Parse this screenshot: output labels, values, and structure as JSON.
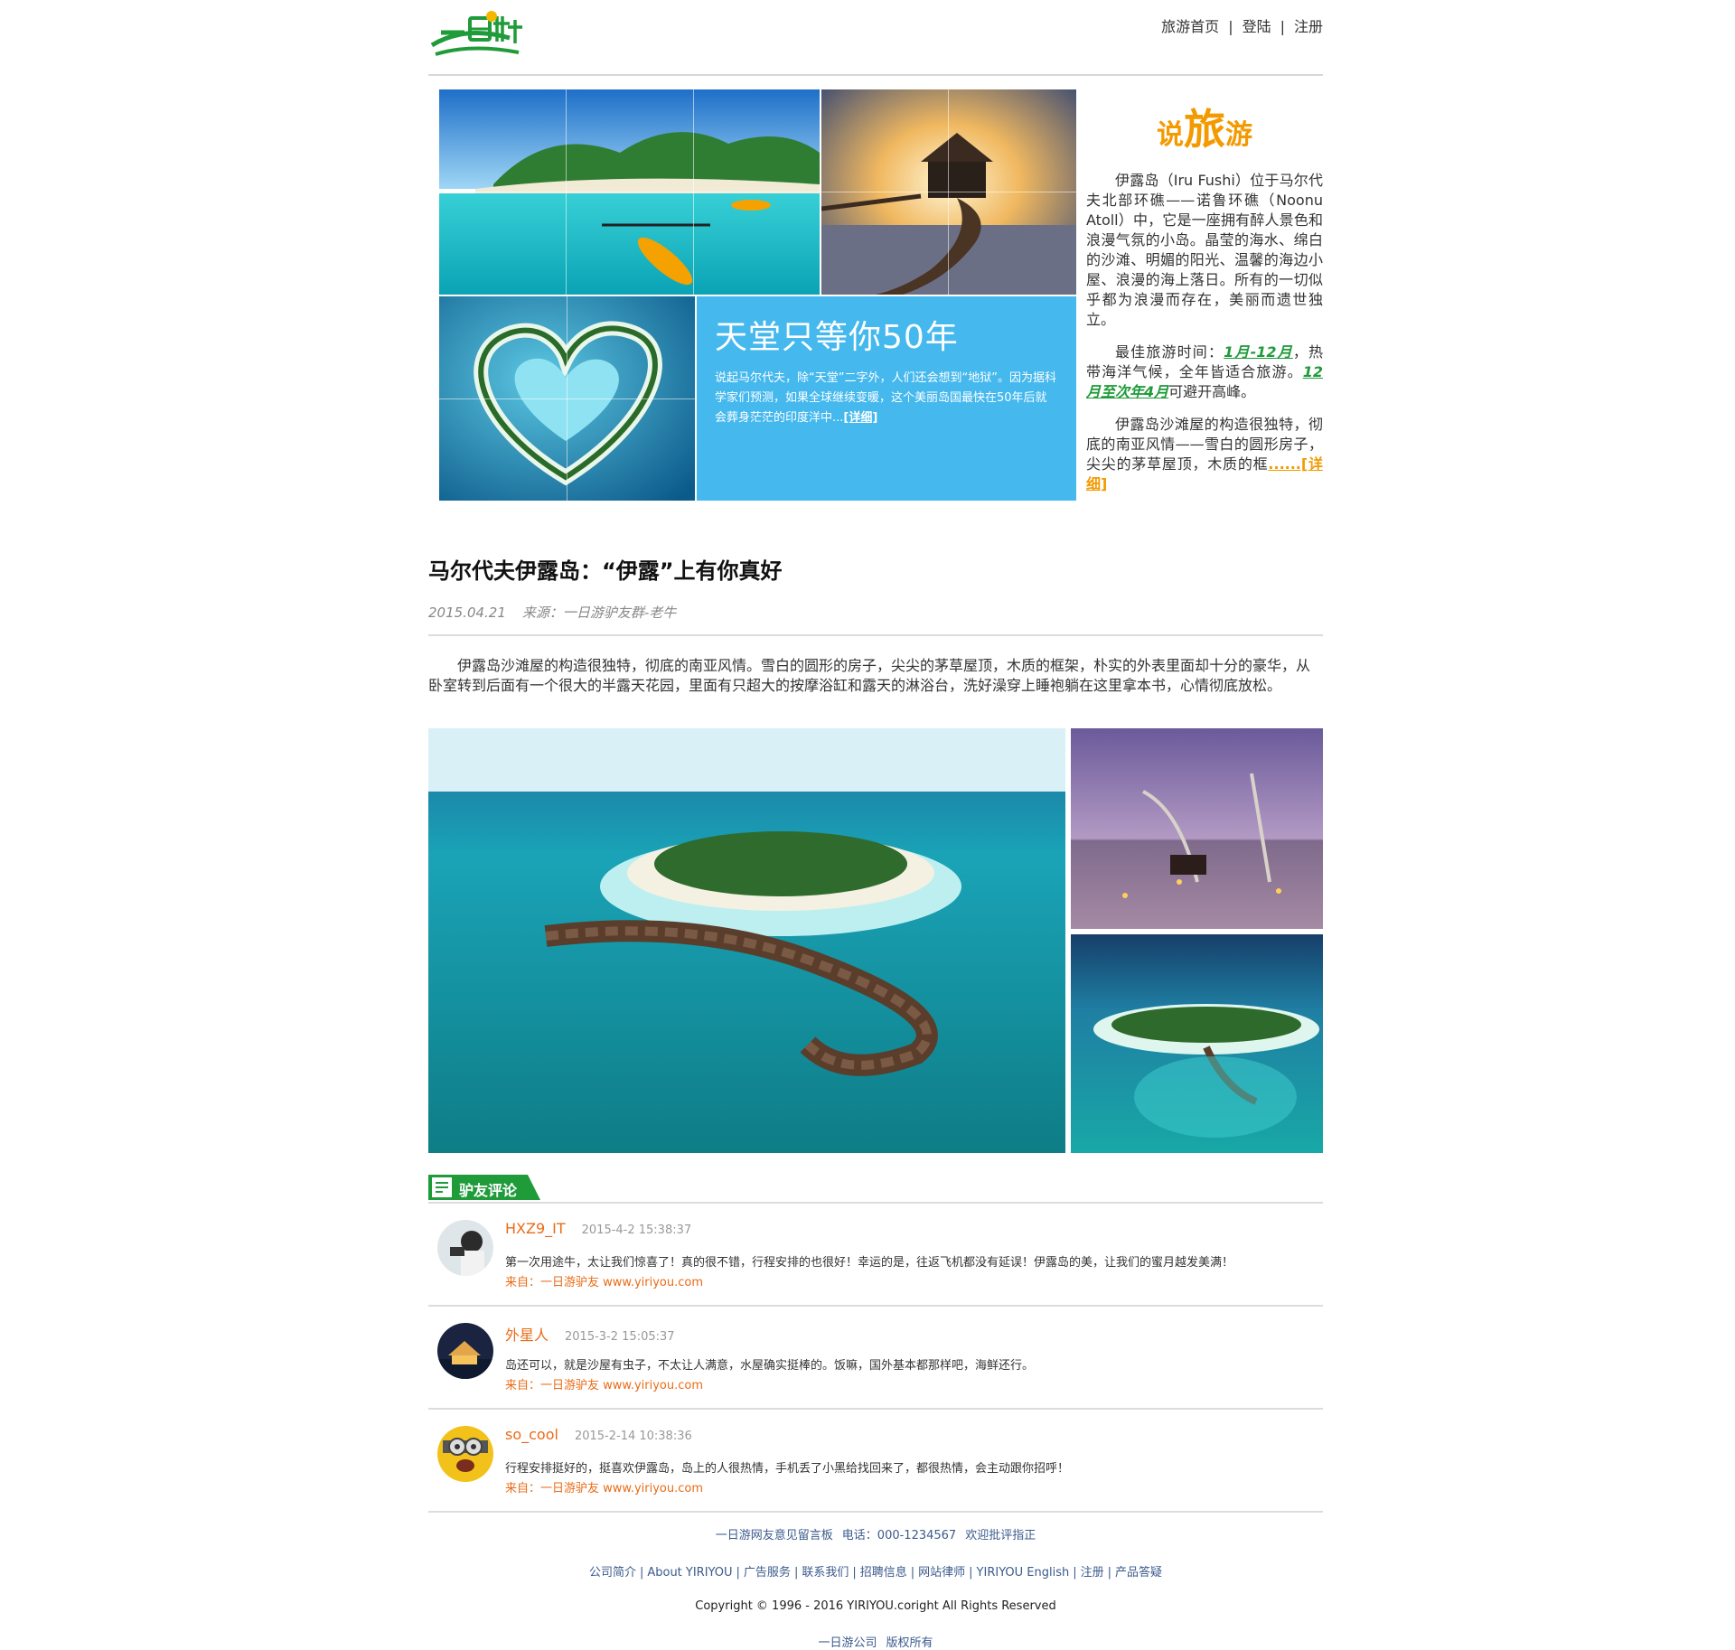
{
  "header": {
    "logo_text": "一日游",
    "nav": [
      {
        "label": "旅游首页"
      },
      {
        "label": "登陆"
      },
      {
        "label": "注册"
      }
    ],
    "separator": "|"
  },
  "hero": {
    "info_title": "天堂只等你50年",
    "info_text": "说起马尔代夫，除“天堂”二字外，人们还会想到“地狱”。因为据科学家们预测，如果全球继续变暖，这个美丽岛国最快在50年后就会葬身茫茫的印度洋中...",
    "info_more": "[详细]"
  },
  "say_travel": {
    "title_pre": "说",
    "title_big": "旅",
    "title_post": "游",
    "p1": "伊露岛（Iru Fushi）位于马尔代夫北部环礁——诺鲁环礁（Noonu Atoll）中，它是一座拥有醉人景色和浪漫气氛的小岛。晶莹的海水、绵白的沙滩、明媚的阳光、温馨的海边小屋、浪漫的海上落日。所有的一切似乎都为浪漫而存在，美丽而遗世独立。",
    "p2_pre": "最佳旅游时间：",
    "p2_hl1": "1月-12月",
    "p2_mid": "，热带海洋气候，全年皆适合旅游。",
    "p2_hl2": "12月至次年4月",
    "p2_post": "可避开高峰。",
    "p3": "伊露岛沙滩屋的构造很独特，彻底的南亚风情——雪白的圆形房子，尖尖的茅草屋顶，木质的框",
    "p3_more": "......[详细]"
  },
  "article": {
    "title": "马尔代夫伊露岛：“伊露”上有你真好",
    "date": "2015.04.21",
    "source": "来源：一日游驴友群-老牛",
    "body": "伊露岛沙滩屋的构造很独特，彻底的南亚风情。雪白的圆形的房子，尖尖的茅草屋顶，木质的框架，朴实的外表里面却十分的豪华，从卧室转到后面有一个很大的半露天花园，里面有只超大的按摩浴缸和露天的淋浴台，洗好澡穿上睡袍躺在这里拿本书，心情彻底放松。"
  },
  "comments_section": {
    "tab_label": "驴友评论",
    "items": [
      {
        "name": "HXZ9_IT",
        "time": "2015-4-2 15:38:37",
        "text": "第一次用途牛，太让我们惊喜了！真的很不错，行程安排的也很好！幸运的是，往返飞机都没有延误！伊露岛的美，让我们的蜜月越发美满！",
        "from": "来自：一日游驴友 www.yiriyou.com"
      },
      {
        "name": "外星人",
        "time": "2015-3-2 15:05:37",
        "text": "岛还可以，就是沙屋有虫子，不太让人满意，水屋确实挺棒的。饭嘛，国外基本都那样吧，海鲜还行。",
        "from": "来自：一日游驴友 www.yiriyou.com"
      },
      {
        "name": "so_cool",
        "time": "2015-2-14 10:38:36",
        "text": "行程安排挺好的，挺喜欢伊露岛，岛上的人很热情，手机丢了小黑给找回来了，都很热情，会主动跟你招呼！",
        "from": "来自：一日游驴友 www.yiriyou.com"
      }
    ]
  },
  "footer": {
    "line1": [
      "一日游网友意见留言板",
      "电话：000-1234567",
      "欢迎批评指正"
    ],
    "links": [
      "公司简介",
      "About YIRIYOU",
      "广告服务",
      "联系我们",
      "招聘信息",
      "网站律师",
      "YIRIYOU English",
      "注册",
      "产品答疑"
    ],
    "copyright": "Copyright © 1996 - 2016 YIRIYOU.coright All Rights Reserved",
    "line4": [
      "一日游公司",
      "版权所有"
    ]
  },
  "colors": {
    "accent_green": "#1f9b3a",
    "accent_orange": "#f39a00",
    "info_blue": "#45b8ee",
    "comment_orange": "#ea6b17",
    "footer_link": "#3b5b8c"
  },
  "icons": {
    "logo": "yiriyou-logo",
    "comment_tab": "list-icon"
  }
}
